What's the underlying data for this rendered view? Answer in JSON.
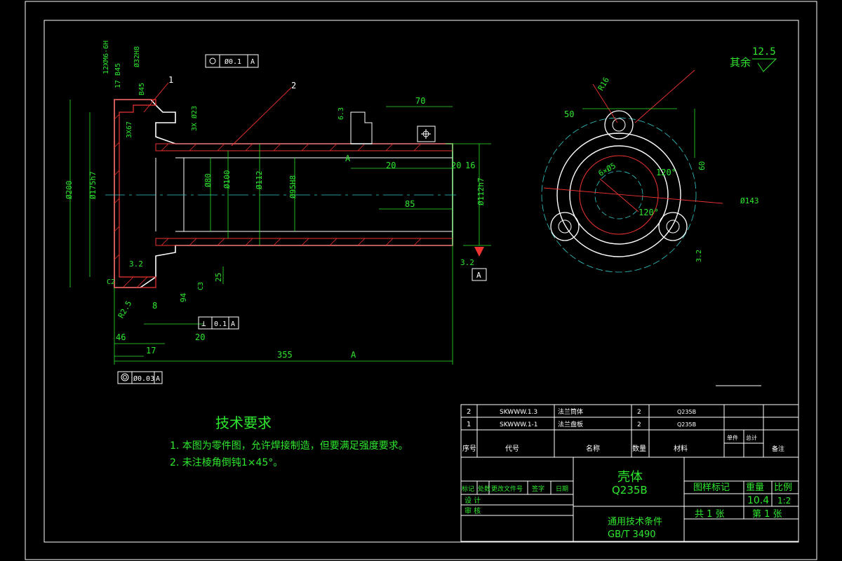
{
  "title_block": {
    "part_name": "壳体",
    "material": "Q235B",
    "standard_line1": "通用技术条件",
    "standard_line2": "GB/T 3490",
    "drawing_mark": "图样标记",
    "weight_label": "重量",
    "scale_label": "比例",
    "weight": "10.4",
    "scale": "1:2",
    "total_sheets": "共 1 张",
    "sheet_no": "第 1 张",
    "rev_headers": [
      "标记",
      "处数",
      "更改文件号",
      "签字",
      "日期"
    ],
    "design": "设 计",
    "review": "审 核"
  },
  "bom": {
    "headers": [
      "序号",
      "代号",
      "名称",
      "数量",
      "材料",
      "单件",
      "总计",
      "备注"
    ],
    "rows": [
      {
        "no": "2",
        "code": "SKWWW.1.3",
        "name": "法兰筒体",
        "qty": "2",
        "mat": "Q235B"
      },
      {
        "no": "1",
        "code": "SKWWW.1-1",
        "name": "法兰盘板",
        "qty": "2",
        "mat": "Q235B"
      }
    ]
  },
  "tech": {
    "title": "技术要求",
    "line1": "1. 本图为零件图，允许焊接制造，但要满足强度要求。",
    "line2": "2. 未注棱角倒钝1×45°。"
  },
  "roughness_rest": {
    "label": "其余",
    "value": "12.5"
  },
  "dims": {
    "d355": "355",
    "a": "A",
    "d46": "46",
    "d17": "17",
    "d20": "20",
    "d8": "8",
    "d94": "94",
    "d25": "25",
    "d70": "70",
    "d85": "85",
    "d20b": "20",
    "d20c": "20",
    "d16": "16",
    "phi200": "Ø200",
    "phi175": "Ø175h7",
    "phi112": "Ø112",
    "phi100": "Ø100",
    "phi80": "Ø80",
    "phi95": "Ø95H8",
    "phi112h7": "Ø112h7",
    "c2": "C2",
    "c3": "C3",
    "r25": "R2.5",
    "r3": "3.2",
    "r63": "6.3",
    "b45": "B45",
    "d3x": "3X67",
    "d3x2": "3X Ø23",
    "m12": "12XM6-6H",
    "t17": "17 B45",
    "phi32": "Ø32H8",
    "leader1": "1",
    "leader2": "2",
    "tol_top": "Ø0.1",
    "tol_perp": "0.1",
    "tol_conc": "Ø0.03",
    "d50": "50",
    "phi143": "Ø143",
    "d120a": "120°",
    "d120b": "120°",
    "r16": "R16",
    "d60": "60",
    "dsq": "6×Ø5",
    "d32b": "3.2"
  }
}
